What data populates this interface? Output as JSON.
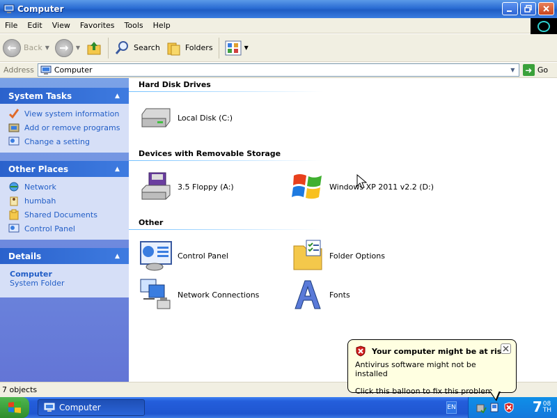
{
  "window": {
    "title": "Computer",
    "buttons": [
      "minimize",
      "maximize",
      "close"
    ]
  },
  "menubar": {
    "items": [
      "File",
      "Edit",
      "View",
      "Favorites",
      "Tools",
      "Help"
    ]
  },
  "toolbar": {
    "back_label": "Back",
    "search_label": "Search",
    "folders_label": "Folders"
  },
  "address": {
    "label": "Address",
    "value": "Computer",
    "go_label": "Go"
  },
  "taskpane": {
    "system_tasks": {
      "title": "System Tasks",
      "items": [
        "View system information",
        "Add or remove programs",
        "Change a setting"
      ]
    },
    "other_places": {
      "title": "Other Places",
      "items": [
        "Network",
        "humbah",
        "Shared Documents",
        "Control Panel"
      ]
    },
    "details": {
      "title": "Details",
      "name": "Computer",
      "type": "System Folder"
    }
  },
  "content": {
    "sections": {
      "hdd": "Hard Disk Drives",
      "removable": "Devices with Removable Storage",
      "other": "Other"
    },
    "items": {
      "local_disk": "Local Disk (C:)",
      "floppy": "3.5 Floppy (A:)",
      "windows_cd": "Windows XP 2011 v2.2 (D:)",
      "control_panel": "Control Panel",
      "folder_options": "Folder Options",
      "network_connections": "Network Connections",
      "fonts": "Fonts"
    }
  },
  "statusbar": {
    "text": "7 objects"
  },
  "taskbar": {
    "task_label": "Computer",
    "language": "EN",
    "clock_hour": "7",
    "clock_min": "08",
    "clock_suffix": "TH"
  },
  "balloon": {
    "title": "Your computer might be at risk",
    "line1": "Antivirus software might not be installed",
    "line2": "Click this balloon to fix this problem."
  },
  "colors": {
    "title_bar": "#2a6cd3",
    "task_pane": "#7ba2e7",
    "link": "#215dc6",
    "balloon_bg": "#ffffe1"
  }
}
